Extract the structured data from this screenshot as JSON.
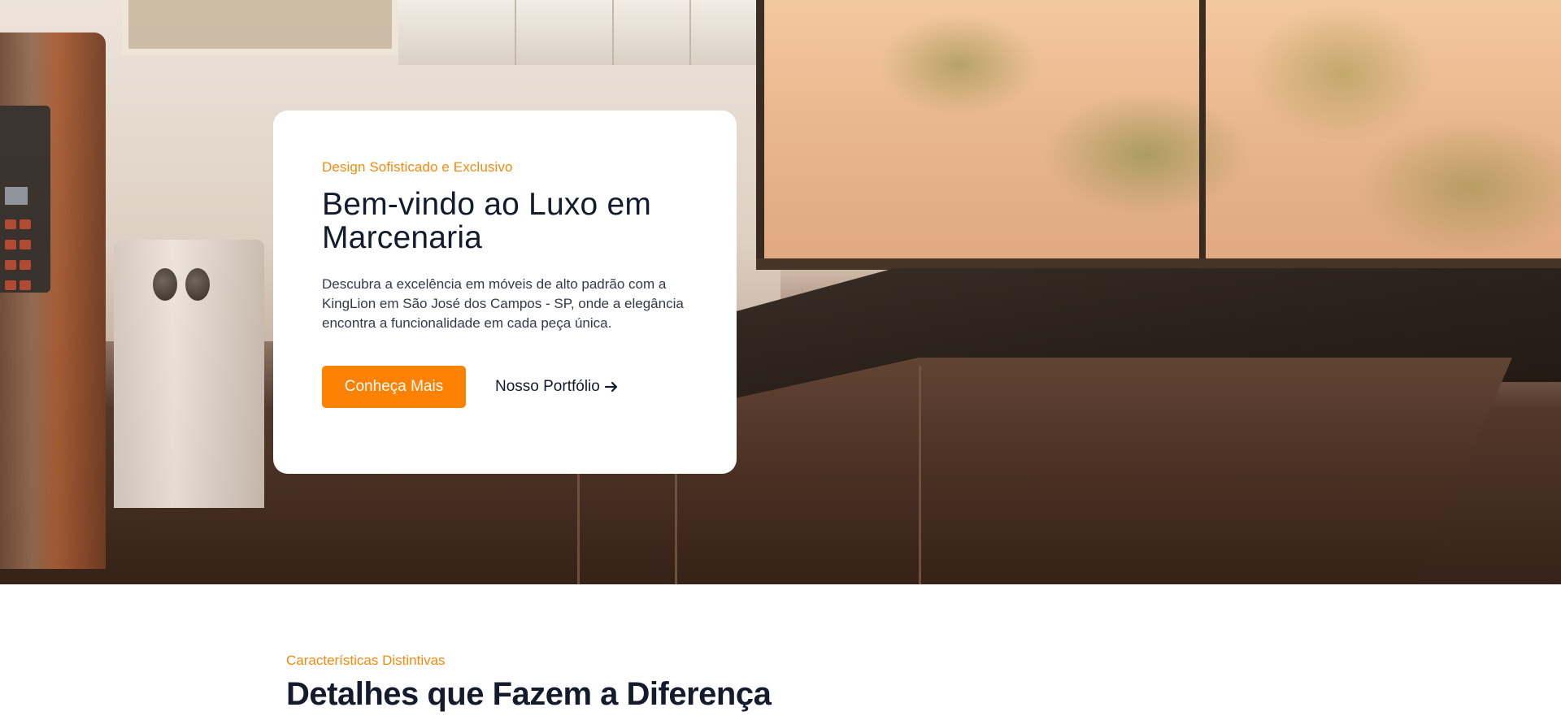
{
  "hero": {
    "eyebrow": "Design Sofisticado e Exclusivo",
    "title": "Bem-vindo ao Luxo em Marcenaria",
    "description": "Descubra a excelência em móveis de alto padrão com a KingLion em São José dos Campos - SP, onde a elegância encontra a funcionalidade em cada peça única.",
    "primary_button": "Conheça Mais",
    "secondary_link": "Nosso Portfólio",
    "secondary_icon": "arrow-right-icon",
    "background_image": "kitchen-interior-photo"
  },
  "features": {
    "eyebrow": "Características Distintivas",
    "title": "Detalhes que Fazem a Diferença"
  },
  "colors": {
    "accent": "#fd8103",
    "accent_text": "#f28a10",
    "heading": "#141b2d",
    "body_text": "#333a47",
    "card_bg": "#ffffff"
  }
}
